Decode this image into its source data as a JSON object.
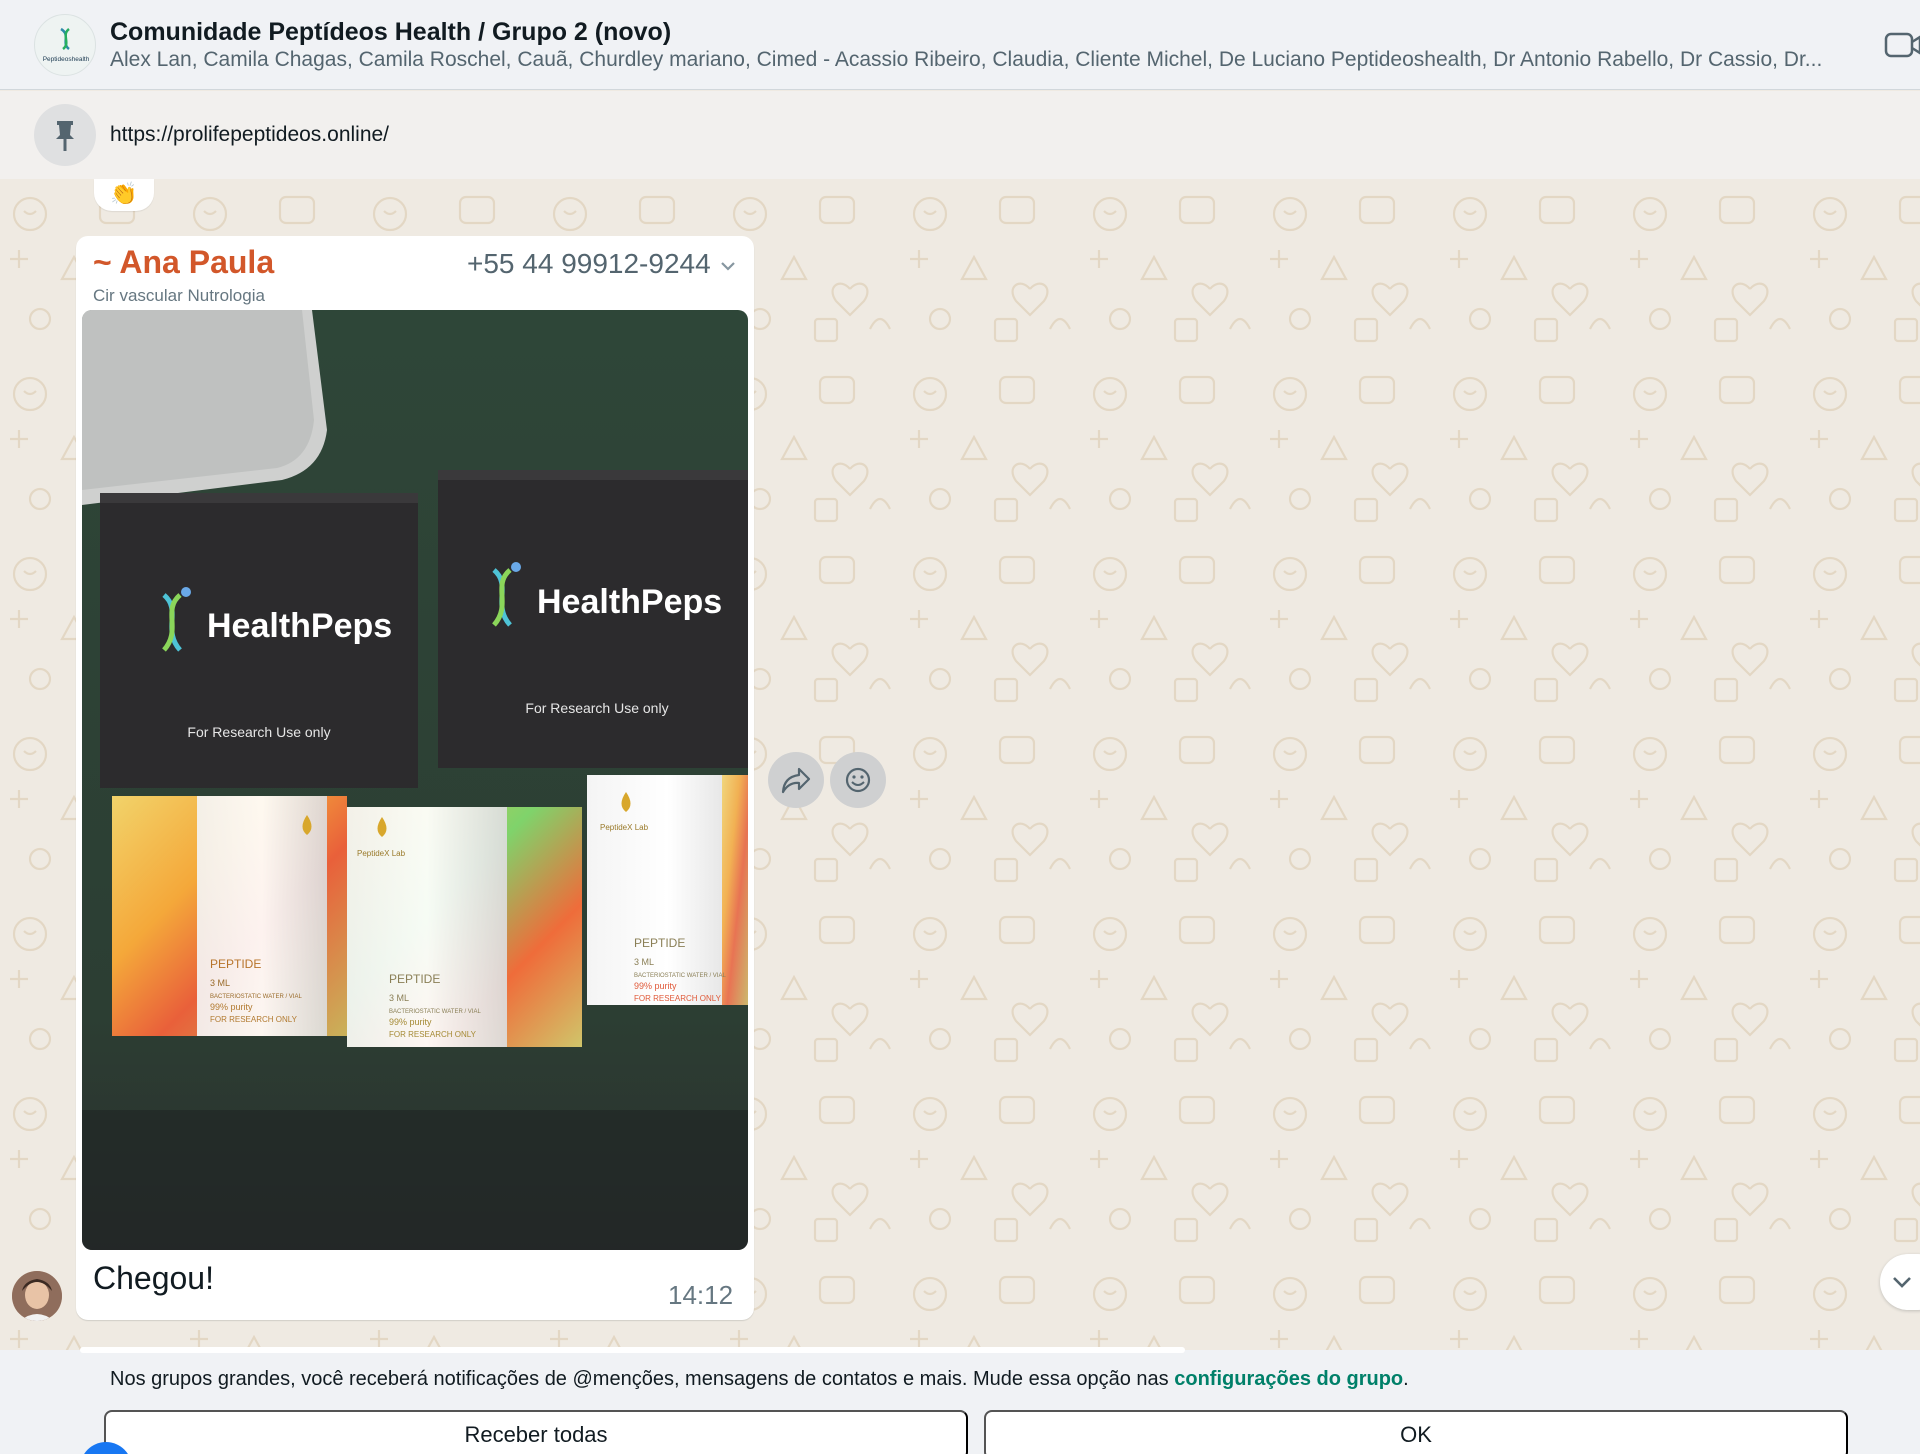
{
  "header": {
    "title": "Comunidade Peptídeos Health / Grupo 2 (novo)",
    "members": "Alex Lan, Camila Chagas, Camila Roschel, Cauã, Churdley mariano, Cimed - Acassio Ribeiro, Claudia, Cliente Michel, De Luciano Peptideoshealth, Dr Antonio Rabello, Dr Cassio, Dr...",
    "avatar_label": "Peptideoshealth",
    "video_icon": "video-camera-icon"
  },
  "pinned": {
    "icon": "pin-icon",
    "text": "https://prolifepeptideos.online/"
  },
  "reaction": {
    "emoji": "👏"
  },
  "message": {
    "sender_name": "~ Ana Paula",
    "sender_phone": "+55 44 99912-9244",
    "sender_subtitle": "Cir vascular Nutrologia",
    "caption": "Chegou!",
    "time": "14:12",
    "photo": {
      "brand": "HealthPeps",
      "box_text": "For Research Use only",
      "vial_brand": "PeptideX Lab",
      "vial_label": "PEPTIDE",
      "vial_line1": "3 ML",
      "vial_line2": "BACTERIOSTATIC WATER / VIAL",
      "vial_line3": "99% purity",
      "vial_line4": "FOR RESEARCH ONLY"
    }
  },
  "hover_actions": {
    "forward_icon": "forward-icon",
    "react_icon": "smiley-icon"
  },
  "notice": {
    "text_before": "Nos grupos grandes, você receberá notificações de @menções, mensagens de contatos e mais. Mude essa opção nas ",
    "link": "configurações do grupo",
    "text_after": ".",
    "button_receive": "Receber todas",
    "button_ok": "OK"
  },
  "colors": {
    "sender_name": "#d2572a",
    "link": "#008069",
    "chat_bg": "#efeae2",
    "header_bg": "#f0f2f5"
  }
}
